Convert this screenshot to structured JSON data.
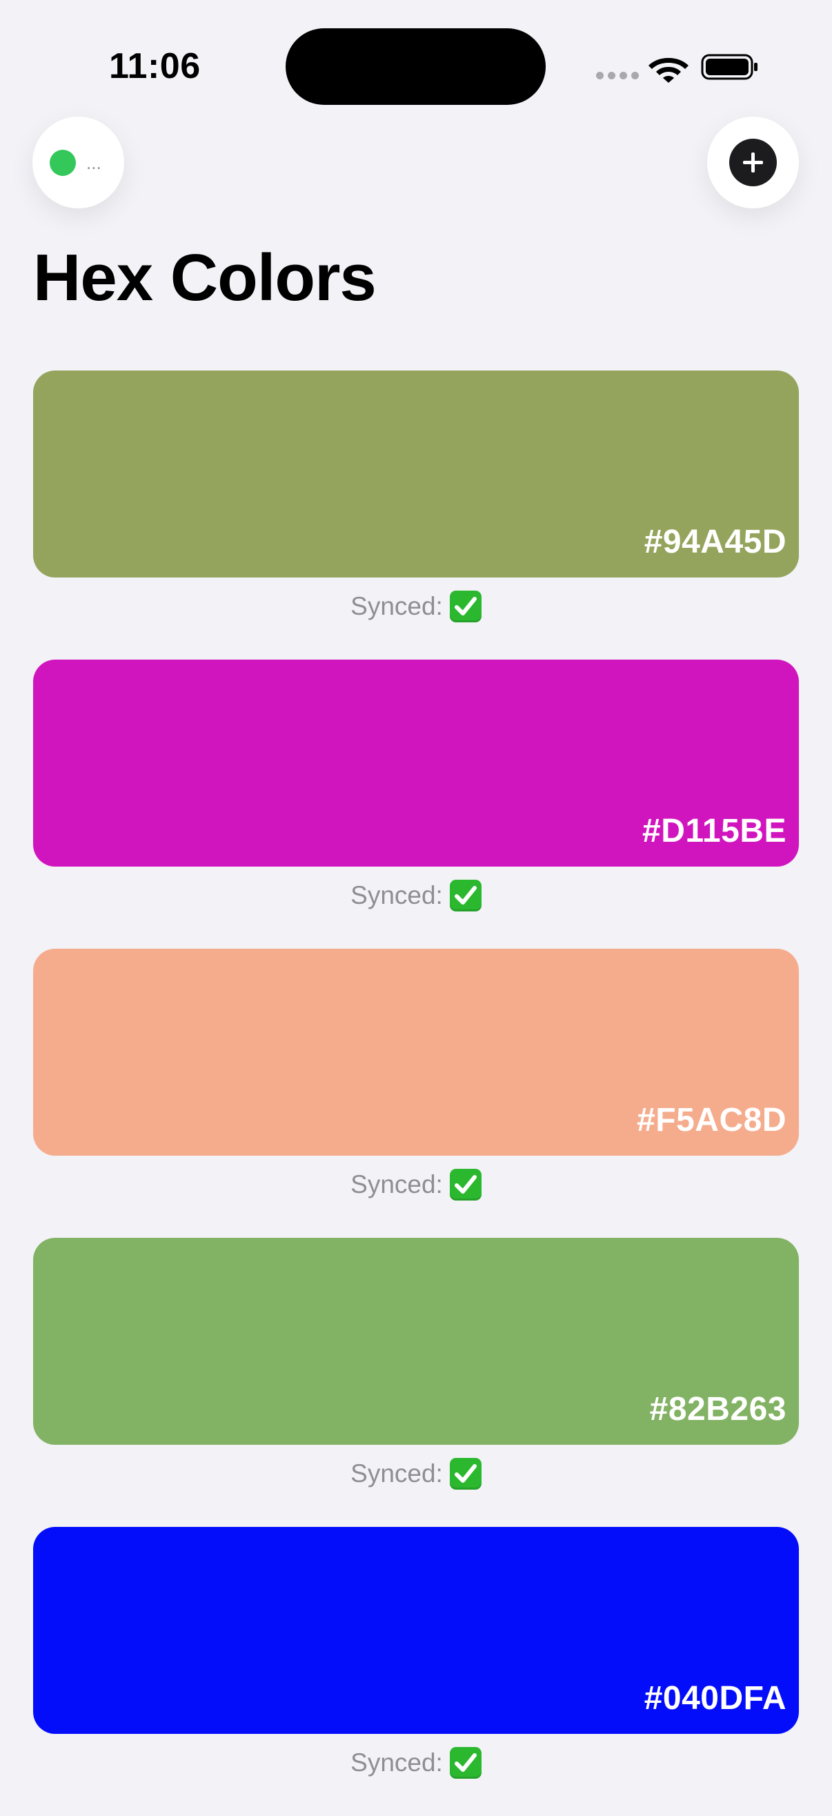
{
  "status_bar": {
    "time": "11:06"
  },
  "header": {
    "status_ellipsis": "...",
    "title": "Hex Colors"
  },
  "colors": [
    {
      "hex": "#94A45D",
      "sync_label": "Synced:"
    },
    {
      "hex": "#D115BE",
      "sync_label": "Synced:"
    },
    {
      "hex": "#F5AC8D",
      "sync_label": "Synced:"
    },
    {
      "hex": "#82B263",
      "sync_label": "Synced:"
    },
    {
      "hex": "#040DFA",
      "sync_label": "Synced:"
    }
  ],
  "icons": {
    "sync_indicator": "green-dot-icon",
    "add": "plus-circle-icon",
    "synced": "check-mark-button-icon"
  },
  "theme": {
    "background": "#F2F2F7",
    "synced_green": "#34C759"
  }
}
